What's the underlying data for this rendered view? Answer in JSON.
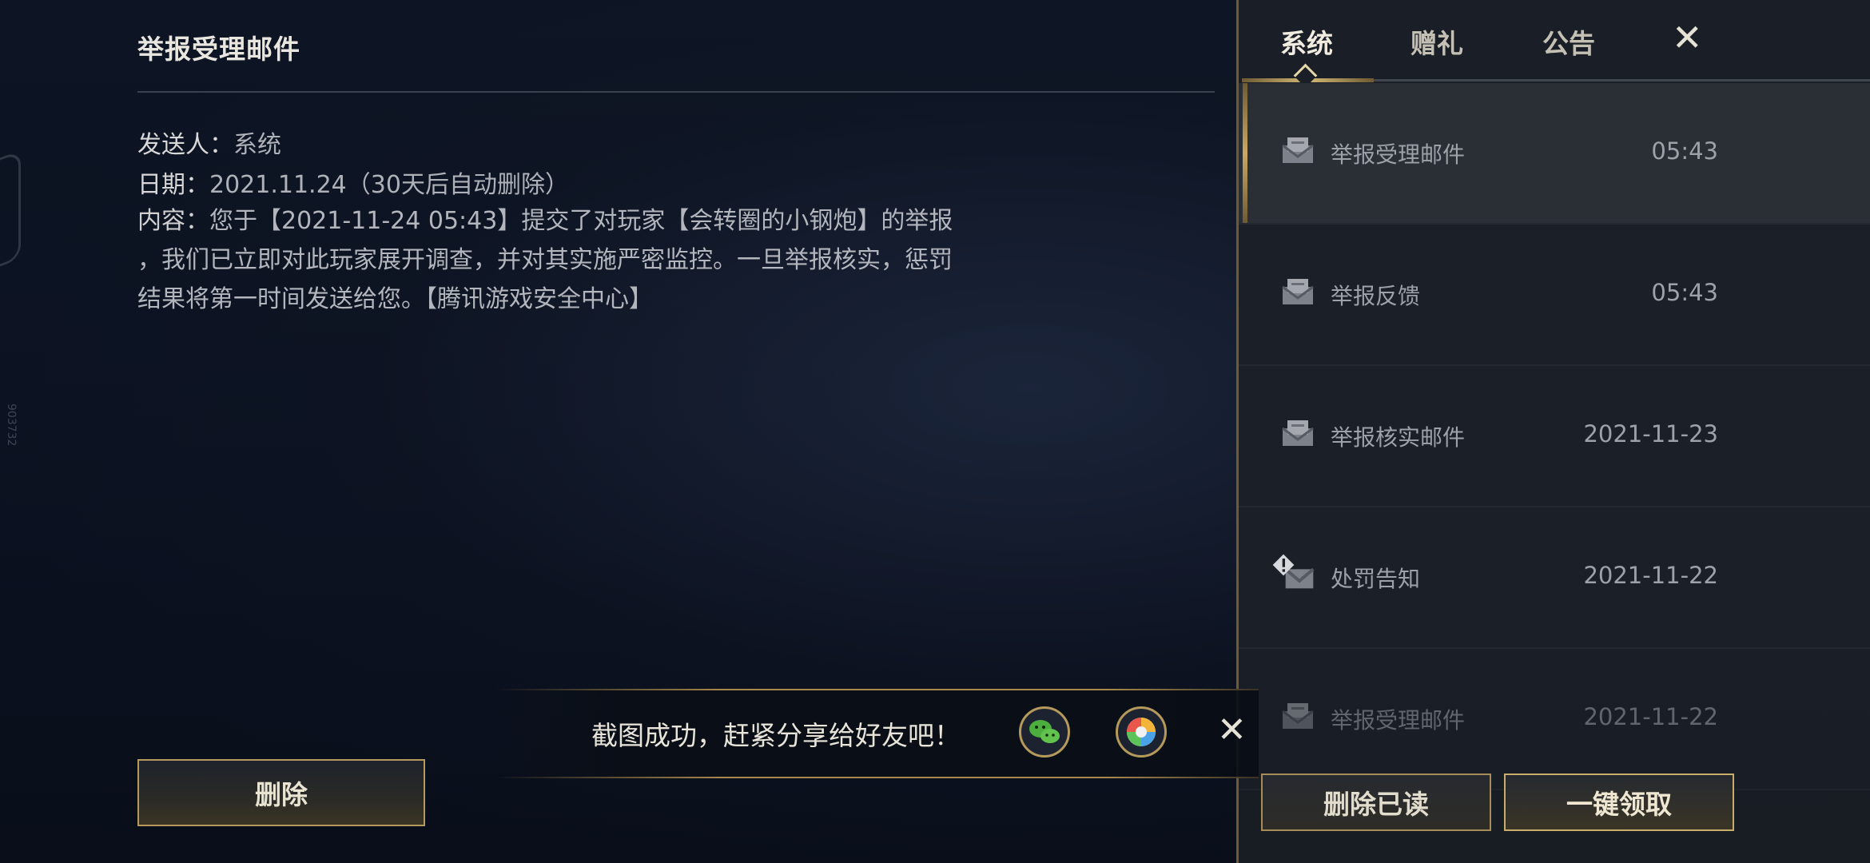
{
  "detail": {
    "title": "举报受理邮件",
    "sender_label": "发送人：",
    "sender_value": "系统",
    "date_label": "日期：",
    "date_value": "2021.11.24（30天后自动删除）",
    "content_label": "内容：",
    "content_line1": "您于【2021-11-24 05:43】提交了对玩家【会转圈的小钢炮】的举报",
    "content_line2": "，我们已立即对此玩家展开调查，并对其实施严密监控。一旦举报核实，惩罚",
    "content_line3": "结果将第一时间发送给您。【腾讯游戏安全中心】",
    "delete_button": "删除"
  },
  "side_id": "903732",
  "tabs": {
    "system": "系统",
    "gift": "赠礼",
    "notice": "公告",
    "close": "✕"
  },
  "mails": [
    {
      "name": "举报受理邮件",
      "time": "05:43",
      "icon": "mail-icon"
    },
    {
      "name": "举报反馈",
      "time": "05:43",
      "icon": "mail-icon"
    },
    {
      "name": "举报核实邮件",
      "time": "2021-11-23",
      "icon": "mail-icon"
    },
    {
      "name": "处罚告知",
      "time": "2021-11-22",
      "icon": "warning-mail-icon"
    },
    {
      "name": "举报受理邮件",
      "time": "2021-11-22",
      "icon": "mail-icon"
    }
  ],
  "actions": {
    "delete_read": "删除已读",
    "claim_all": "一键领取"
  },
  "toast": {
    "text": "截图成功，赶紧分享给好友吧！",
    "close": "✕"
  },
  "colors": {
    "accent_gold": "#c9ad6a",
    "panel_bg": "#1a1f27",
    "page_bg": "#0b1220"
  }
}
